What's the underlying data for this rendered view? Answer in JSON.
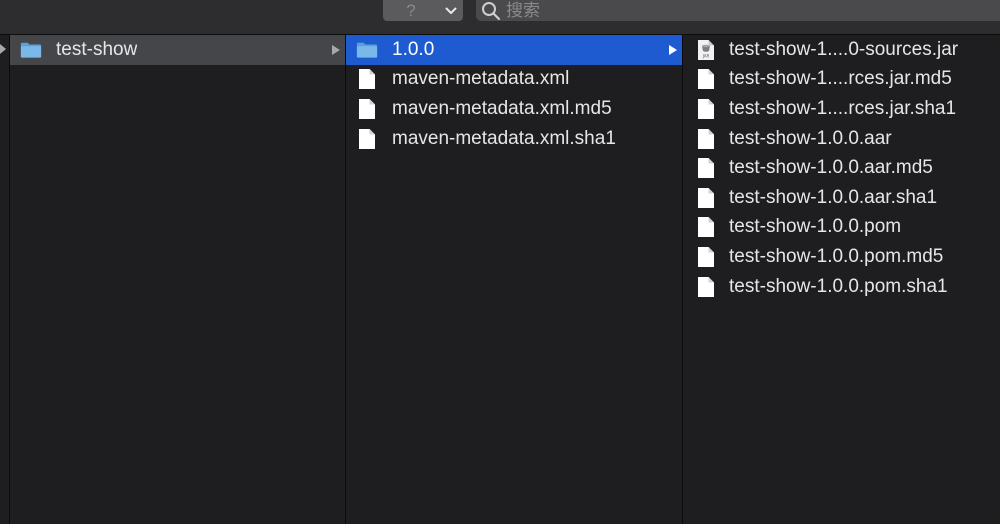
{
  "toolbar": {
    "help_glyph": "?",
    "search": {
      "placeholder": "搜索",
      "value": ""
    }
  },
  "columns": {
    "column_1": {
      "items": [
        {
          "label": "test-show",
          "type": "folder",
          "selected": "inactive",
          "has_children": true
        }
      ]
    },
    "column_2": {
      "items": [
        {
          "label": "1.0.0",
          "type": "folder",
          "selected": "active",
          "has_children": true
        },
        {
          "label": "maven-metadata.xml",
          "type": "file"
        },
        {
          "label": "maven-metadata.xml.md5",
          "type": "file"
        },
        {
          "label": "maven-metadata.xml.sha1",
          "type": "file"
        }
      ]
    },
    "column_3": {
      "items": [
        {
          "label": "test-show-1....0-sources.jar",
          "type": "jar-file",
          "icon_text": "JAR"
        },
        {
          "label": "test-show-1....rces.jar.md5",
          "type": "file"
        },
        {
          "label": "test-show-1....rces.jar.sha1",
          "type": "file"
        },
        {
          "label": "test-show-1.0.0.aar",
          "type": "file"
        },
        {
          "label": "test-show-1.0.0.aar.md5",
          "type": "file"
        },
        {
          "label": "test-show-1.0.0.aar.sha1",
          "type": "file"
        },
        {
          "label": "test-show-1.0.0.pom",
          "type": "file"
        },
        {
          "label": "test-show-1.0.0.pom.md5",
          "type": "file"
        },
        {
          "label": "test-show-1.0.0.pom.sha1",
          "type": "file"
        }
      ]
    }
  },
  "colors": {
    "background": "#1e1e21",
    "selection_active": "#1f5bd0",
    "selection_inactive": "#45464a",
    "folder": "#74b3e6"
  }
}
